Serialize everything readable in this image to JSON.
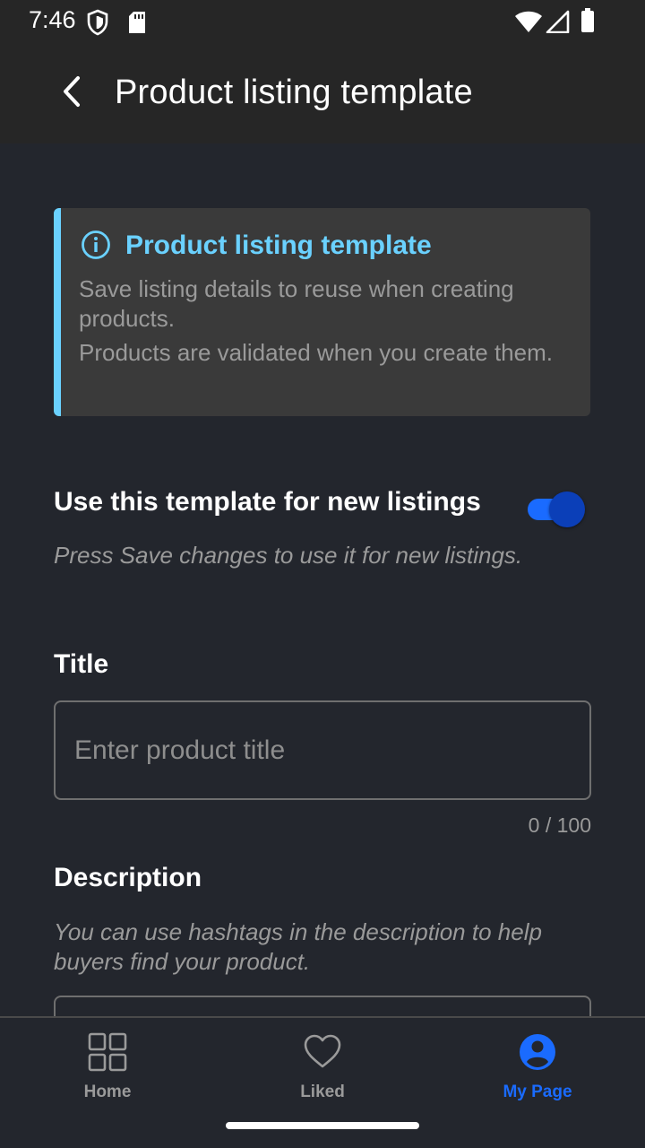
{
  "status_bar": {
    "time": "7:46",
    "icons": [
      "shield-icon",
      "sd-card-icon",
      "wifi-icon",
      "signal-icon",
      "battery-icon"
    ]
  },
  "app_bar": {
    "title": "Product listing template",
    "back_icon": "chevron-left-icon"
  },
  "info_card": {
    "title": "Product listing template",
    "line1": "Save listing details to reuse when creating products.",
    "line2": "Products are validated when you create them.",
    "accent_color": "#6ad1ff"
  },
  "template_toggle": {
    "label": "Use this template for new listings",
    "hint": "Press Save changes to use it for new listings.",
    "enabled": true
  },
  "title_field": {
    "label": "Title",
    "placeholder": "Enter product title",
    "value": "",
    "counter": "0 / 100"
  },
  "description_field": {
    "label": "Description",
    "hint": "You can use hashtags in the description to help buyers find your product."
  },
  "bottom_nav": {
    "items": [
      {
        "label": "Home",
        "icon": "grid-icon",
        "active": false
      },
      {
        "label": "Liked",
        "icon": "heart-icon",
        "active": false
      },
      {
        "label": "My Page",
        "icon": "profile-icon",
        "active": true
      }
    ],
    "active_color": "#1a6bff"
  }
}
